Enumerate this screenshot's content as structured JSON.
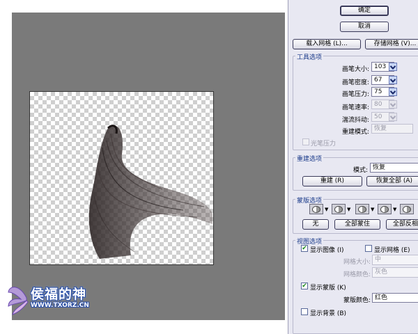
{
  "dialog": {
    "ok_label": "确定",
    "cancel_label": "取消",
    "load_mesh_label": "载入网格 (L)...",
    "save_mesh_label": "存储网格 (V)..."
  },
  "tool_options": {
    "title": "工具选项",
    "brush_size": {
      "label": "画笔大小:",
      "value": "103"
    },
    "brush_density": {
      "label": "画笔密度:",
      "value": "67"
    },
    "brush_pressure": {
      "label": "画笔压力:",
      "value": "75"
    },
    "brush_rate": {
      "label": "画笔速率:",
      "value": "80"
    },
    "turbulent_jitter": {
      "label": "湍流抖动:",
      "value": "50"
    },
    "reconstruct_mode": {
      "label": "重建模式:",
      "value": "恢复"
    },
    "stylus_pressure": {
      "label": "光笔压力"
    }
  },
  "reconstruct_options": {
    "title": "重建选项",
    "mode_label": "模式:",
    "mode_value": "恢复",
    "reconstruct_label": "重建 (R)",
    "restore_all_label": "恢复全部 (A)"
  },
  "mask_options": {
    "title": "蒙版选项",
    "none_label": "无",
    "mask_all_label": "全部蒙住",
    "invert_all_label": "全部反相"
  },
  "view_options": {
    "title": "视图选项",
    "show_image": {
      "label": "显示图像 (I)",
      "checked": true
    },
    "show_mesh": {
      "label": "显示网格 (E)",
      "checked": false
    },
    "mesh_size": {
      "label": "网格大小:",
      "value": "中"
    },
    "mesh_color": {
      "label": "网格颜色:",
      "value": "灰色"
    },
    "show_mask": {
      "label": "显示蒙版 (K)",
      "checked": true
    },
    "mask_color": {
      "label": "蒙版颜色:",
      "value": "红色"
    },
    "show_backdrop": {
      "label": "显示背景 (B)",
      "checked": false
    }
  },
  "logo": {
    "title": "侯福的神",
    "url": "WWW.TXORZ.CN"
  },
  "icons": {
    "dropdown": "chevron-down-icon",
    "mask": "mask-circle-icon",
    "check": "check-icon"
  },
  "colors": {
    "canvas_bg": "#7a7a7a",
    "panel_bg": "#e8e8f2",
    "group_title": "#1a3a8a"
  }
}
